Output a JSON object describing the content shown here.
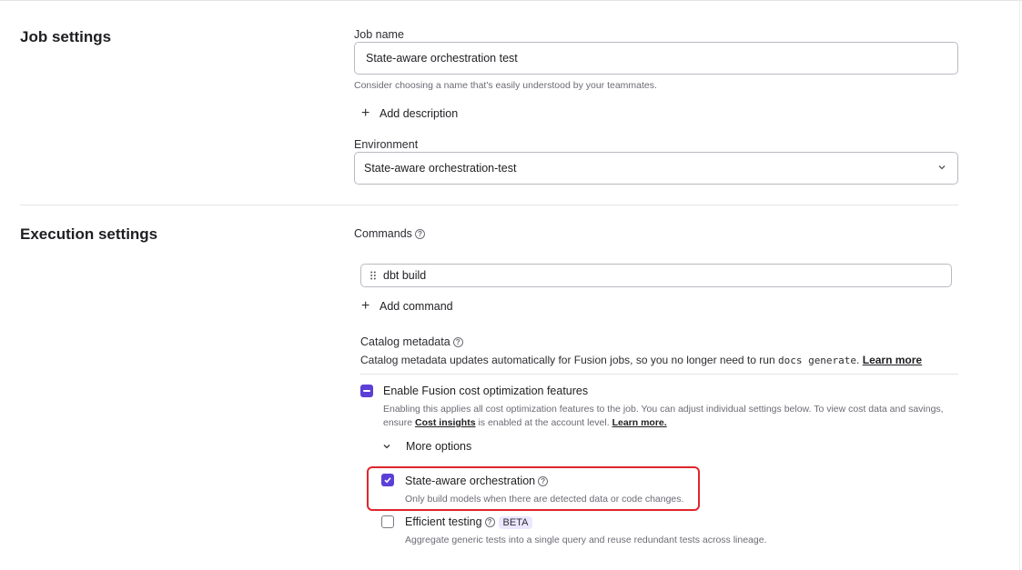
{
  "job_settings": {
    "title": "Job settings",
    "job_name_label": "Job name",
    "job_name_value": "State-aware orchestration test",
    "job_name_helper": "Consider choosing a name that's easily understood by your teammates.",
    "add_description_label": "Add description",
    "environment_label": "Environment",
    "environment_value": "State-aware orchestration-test"
  },
  "execution_settings": {
    "title": "Execution settings",
    "commands_label": "Commands",
    "commands": [
      {
        "value": "dbt build"
      }
    ],
    "add_command_label": "Add command",
    "catalog_label": "Catalog metadata",
    "catalog_text_pre": "Catalog metadata updates automatically for Fusion jobs, so you no longer need to run ",
    "catalog_code": "docs generate",
    "catalog_text_post": ".",
    "catalog_link": "Learn more",
    "fusion": {
      "label": "Enable Fusion cost optimization features",
      "state": "indeterminate",
      "desc_pre": "Enabling this applies all cost optimization features to the job. You can adjust individual settings below. To view cost data and savings, ensure ",
      "desc_link": "Cost insights",
      "desc_mid": " is enabled at the account level. ",
      "desc_link2": "Learn more."
    },
    "more_options_label": "More options",
    "options": [
      {
        "label": "State-aware orchestration",
        "desc": "Only build models when there are detected data or code changes.",
        "checked": true
      },
      {
        "label": "Efficient testing",
        "badge": "BETA",
        "desc": "Aggregate generic tests into a single query and reuse redundant tests across lineage.",
        "checked": false
      }
    ]
  },
  "colors": {
    "accent": "#5b3fd6",
    "highlight": "#e0262c",
    "beta_bg": "#ece7ff"
  }
}
